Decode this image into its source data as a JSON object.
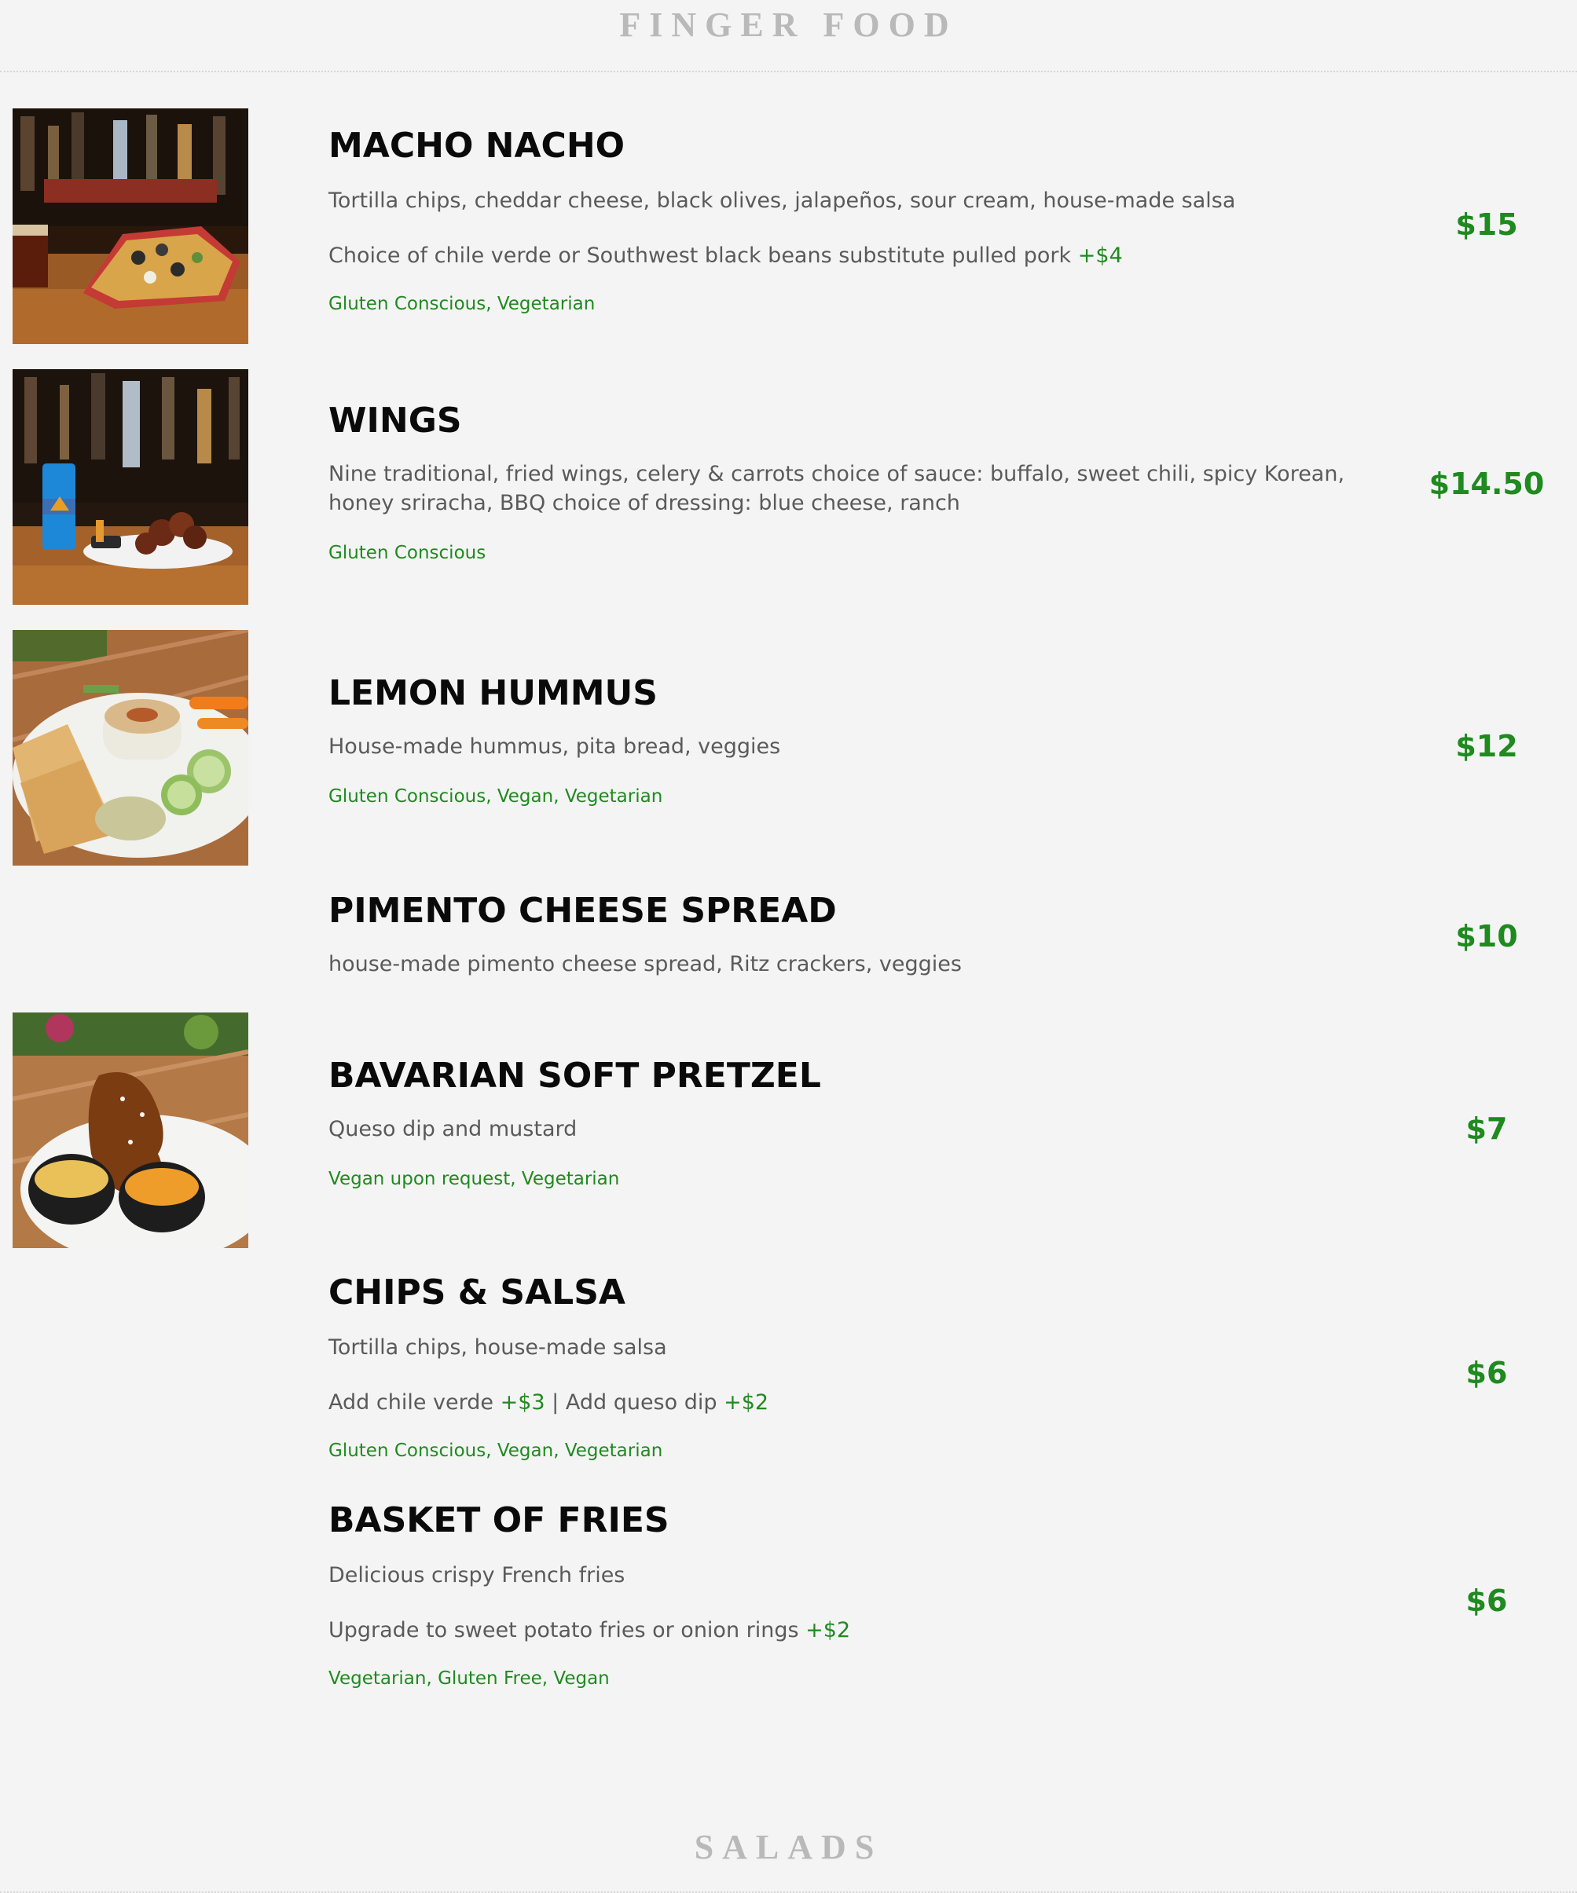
{
  "sections": {
    "finger_food_title": "FINGER FOOD",
    "salads_title": "SALADS"
  },
  "colors": {
    "background": "#f4f4f4",
    "title_gray": "#b9b9b9",
    "price_green": "#1f8a1f",
    "text_gray": "#5a5a5a"
  },
  "items": {
    "macho_nacho": {
      "name": "MACHO NACHO",
      "desc1": "Tortilla chips, cheddar cheese, black olives, jalapeños, sour cream, house-made salsa",
      "desc2": "Choice of chile verde or Southwest black beans substitute pulled pork",
      "desc2_addon": "+$4",
      "tags": "Gluten Conscious, Vegetarian",
      "price": "$15"
    },
    "wings": {
      "name": "WINGS",
      "desc1": "Nine traditional, fried wings, celery & carrots choice of sauce: buffalo, sweet chili, spicy Korean, honey sriracha, BBQ choice of dressing: blue cheese, ranch",
      "tags": "Gluten Conscious",
      "price": "$14.50"
    },
    "lemon_hummus": {
      "name": "LEMON HUMMUS",
      "desc1": "House-made hummus, pita bread, veggies",
      "tags": "Gluten Conscious, Vegan, Vegetarian",
      "price": "$12"
    },
    "pimento": {
      "name": "PIMENTO CHEESE SPREAD",
      "desc1": "house-made pimento cheese spread, Ritz crackers, veggies",
      "price": "$10"
    },
    "pretzel": {
      "name": "BAVARIAN SOFT PRETZEL",
      "desc1": "Queso dip and mustard",
      "tags": "Vegan upon request, Vegetarian",
      "price": "$7"
    },
    "chips_salsa": {
      "name": "CHIPS & SALSA",
      "desc1": "Tortilla chips, house-made salsa",
      "desc2a": "Add chile verde",
      "desc2a_addon": "+$3",
      "desc2_sep": "| Add queso dip",
      "desc2b_addon": "+$2",
      "tags": "Gluten Conscious, Vegan, Vegetarian",
      "price": "$6"
    },
    "fries": {
      "name": "BASKET OF FRIES",
      "desc1": "Delicious crispy French fries",
      "desc2": "Upgrade to sweet potato fries or onion rings",
      "desc2_addon": "+$2",
      "tags": "Vegetarian, Gluten Free, Vegan",
      "price": "$6"
    }
  }
}
